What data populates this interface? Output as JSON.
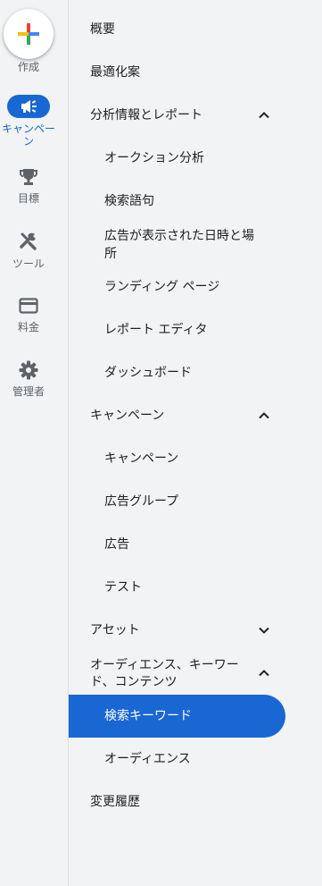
{
  "rail": {
    "create_label": "作成",
    "campaigns_label_line1": "キャンペー",
    "campaigns_label_line2": "ン",
    "goals_label": "目標",
    "tools_label": "ツール",
    "billing_label": "料金",
    "admin_label": "管理者"
  },
  "menu": {
    "overview": "概要",
    "optimization": "最適化案",
    "insights_reports": "分析情報とレポート",
    "auction_insights": "オークション分析",
    "search_terms": "検索語句",
    "where_when_line1": "広告が表示された日時と場",
    "where_when_line2": "所",
    "landing_pages": "ランディング ページ",
    "report_editor": "レポート エディタ",
    "dashboards": "ダッシュボード",
    "campaigns_section": "キャンペーン",
    "campaigns": "キャンペーン",
    "ad_groups": "広告グループ",
    "ads": "広告",
    "experiments": "テスト",
    "assets": "アセット",
    "audiences_section_line1": "オーディエンス、キーワー",
    "audiences_section_line2": "ド、コンテンツ",
    "search_keywords": "検索キーワード",
    "audiences": "オーディエンス",
    "change_history": "変更履歴"
  },
  "colors": {
    "accent": "#1967d2",
    "background": "#f1f3f4",
    "text": "#202124",
    "muted": "#5f6368"
  }
}
